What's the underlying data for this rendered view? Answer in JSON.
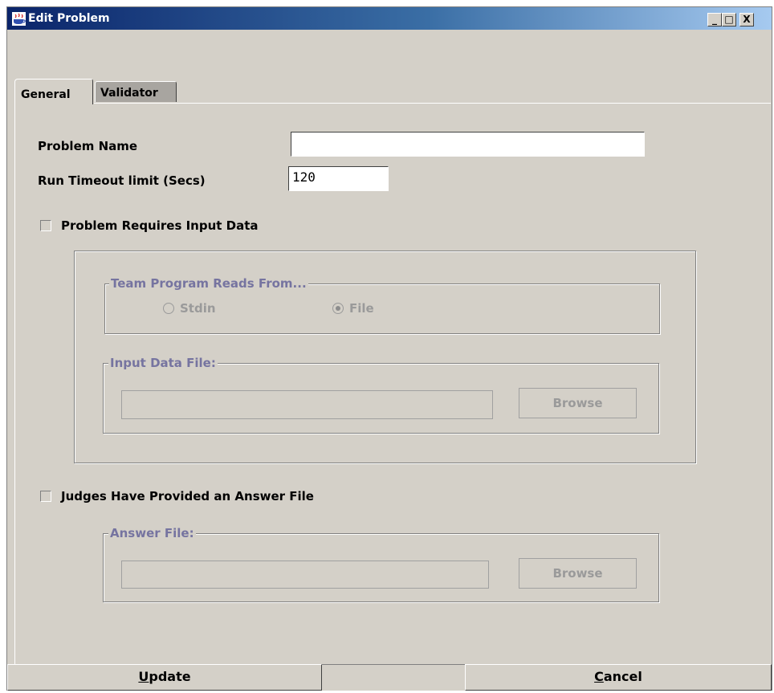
{
  "window": {
    "title": "Edit Problem",
    "controls": {
      "minimize": "_",
      "maximize": "□",
      "close": "X"
    }
  },
  "tabs": [
    {
      "label": "General",
      "selected": true
    },
    {
      "label": "Validator",
      "selected": false
    }
  ],
  "form": {
    "problem_name_label": "Problem Name",
    "problem_name_value": "",
    "timeout_label": "Run Timeout limit (Secs)",
    "timeout_value": "120",
    "requires_input_label": "Problem Requires Input Data",
    "requires_input_checked": false,
    "reads_from_legend": "Team Program Reads From...",
    "stdin_label": "Stdin",
    "file_label": "File",
    "selected_source": "File",
    "input_file_legend": "Input Data File:",
    "input_file_value": "",
    "browse_label": "Browse",
    "answer_checkbox_label": "Judges Have Provided an Answer File",
    "answer_checked": false,
    "answer_file_legend": "Answer File:",
    "answer_file_value": "",
    "answer_browse_label": "Browse"
  },
  "footer": {
    "update_mnemonic": "U",
    "update_rest": "pdate",
    "cancel_mnemonic": "C",
    "cancel_rest": "ancel"
  },
  "colors": {
    "window_bg": "#d4d0c8",
    "title_gradient_start": "#0a246a",
    "title_gradient_end": "#a6caf0",
    "disabled_legend": "#7674a0",
    "disabled_text": "#9a9a9a"
  }
}
